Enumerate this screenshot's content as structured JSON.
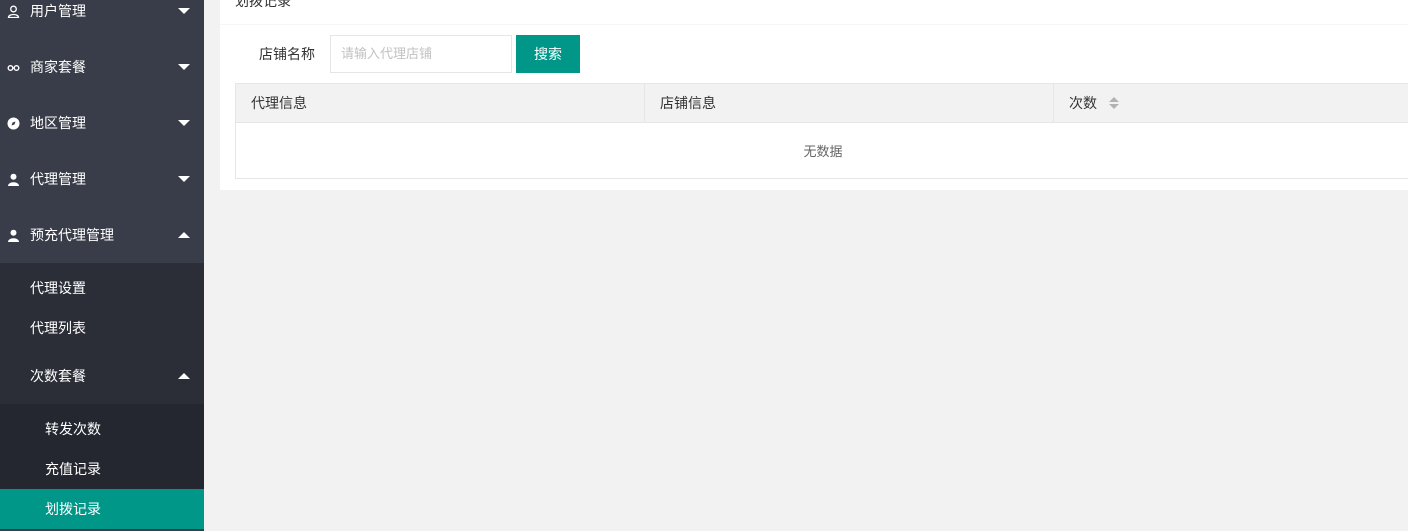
{
  "sidebar": {
    "groups": [
      {
        "label": "用户管理",
        "icon": "user-outline-icon"
      },
      {
        "label": "商家套餐",
        "icon": "link-icon"
      },
      {
        "label": "地区管理",
        "icon": "compass-icon"
      },
      {
        "label": "代理管理",
        "icon": "user-icon"
      },
      {
        "label": "预充代理管理",
        "icon": "user-icon"
      }
    ],
    "sub_items": [
      {
        "label": "代理设置"
      },
      {
        "label": "代理列表"
      }
    ],
    "sub_group": {
      "label": "次数套餐"
    },
    "subsub_items": [
      {
        "label": "转发次数"
      },
      {
        "label": "充值记录"
      },
      {
        "label": "划拨记录"
      }
    ]
  },
  "main": {
    "title": "划拨记录",
    "search": {
      "label": "店铺名称",
      "placeholder": "请输入代理店铺",
      "button": "搜索"
    },
    "table": {
      "columns": [
        "代理信息",
        "店铺信息",
        "次数"
      ],
      "empty_text": "无数据"
    }
  },
  "colors": {
    "sidebar_bg": "#393d49",
    "accent": "#009688"
  }
}
